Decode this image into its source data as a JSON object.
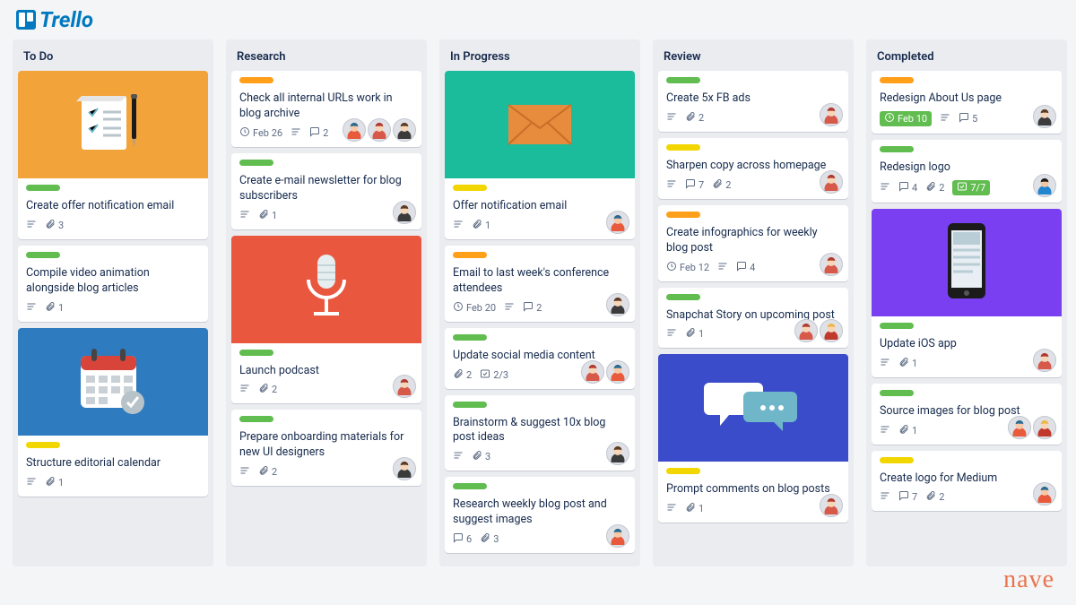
{
  "app": {
    "logo_text": "Trello"
  },
  "footer": {
    "brand": "nave"
  },
  "avatars": {
    "a1": {
      "hair": "#2b6a8f",
      "skin": "#f7c9a8",
      "shirt": "#e85a3b"
    },
    "a2": {
      "hair": "#5b3b22",
      "skin": "#f7d6b8",
      "shirt": "#3b3b3b"
    },
    "a3": {
      "hair": "#1a1a1a",
      "skin": "#f2c6a0",
      "shirt": "#2185d0"
    },
    "a4": {
      "hair": "#b03a2e",
      "skin": "#f7d6b8",
      "shirt": "#d7594a"
    },
    "a5": {
      "hair": "#f0b84a",
      "skin": "#f7d6b8",
      "shirt": "#c0392b"
    }
  },
  "colors": {
    "cover_orange": "#f2a33a",
    "cover_blue": "#2e7bbf",
    "cover_red": "#e9573f",
    "cover_teal": "#1abc9c",
    "cover_indigo": "#3b4cca",
    "cover_purple": "#7b3ff2"
  },
  "lists": [
    {
      "title": "To Do",
      "cards": [
        {
          "cover": "note_orange",
          "label": "green",
          "title": "Create offer notification email",
          "badges": {
            "desc": true,
            "attach": 3
          }
        },
        {
          "label": "green",
          "title": "Compile video animation alongside blog articles",
          "badges": {
            "desc": true,
            "attach": 1
          }
        },
        {
          "cover": "calendar_blue",
          "label": "yellow",
          "title": "Structure editorial calendar",
          "badges": {
            "desc": true,
            "attach": 1
          }
        }
      ]
    },
    {
      "title": "Research",
      "cards": [
        {
          "label": "orange",
          "title": "Check all internal URLs work in blog archive",
          "badges": {
            "due": "Feb 26",
            "desc": true,
            "comments": 2
          },
          "members": [
            "a1",
            "a4",
            "a2"
          ]
        },
        {
          "label": "green",
          "title": "Create e-mail newsletter for blog subscribers",
          "badges": {
            "desc": true,
            "attach": 1
          },
          "members": [
            "a2"
          ]
        },
        {
          "cover": "mic_red",
          "label": "green",
          "title": "Launch podcast",
          "badges": {
            "desc": true,
            "attach": 2
          },
          "members": [
            "a4"
          ]
        },
        {
          "label": "green",
          "title": "Prepare onboarding materials for new UI designers",
          "badges": {
            "desc": true,
            "attach": 2
          },
          "members": [
            "a2"
          ]
        }
      ]
    },
    {
      "title": "In Progress",
      "cards": [
        {
          "cover": "mail_teal",
          "label": "yellow",
          "title": "Offer notification email",
          "badges": {
            "desc": true,
            "attach": 1
          },
          "members": [
            "a1"
          ]
        },
        {
          "label": "orange",
          "title": "Email to last week's conference attendees",
          "badges": {
            "due": "Feb 20",
            "desc": true,
            "comments": 2
          },
          "members": [
            "a2"
          ]
        },
        {
          "label": "green",
          "title": "Update social media content",
          "badges": {
            "attach": 2,
            "check": "2/3"
          },
          "members": [
            "a4",
            "a1"
          ]
        },
        {
          "label": "green",
          "title": "Brainstorm & suggest 10x blog post ideas",
          "badges": {
            "desc": true,
            "attach": 3
          },
          "members": [
            "a2"
          ]
        },
        {
          "label": "green",
          "title": "Research weekly blog post and suggest images",
          "badges": {
            "attach": 3,
            "comments": 6
          },
          "members": [
            "a1"
          ]
        }
      ]
    },
    {
      "title": "Review",
      "cards": [
        {
          "label": "green",
          "title": "Create 5x FB ads",
          "badges": {
            "desc": true,
            "attach": 2
          },
          "members": [
            "a4"
          ]
        },
        {
          "label": "yellow",
          "title": "Sharpen copy across homepage",
          "badges": {
            "desc": true,
            "comments": 7,
            "attach": 2
          },
          "members": [
            "a4"
          ]
        },
        {
          "label": "orange",
          "title": "Create infographics for weekly blog post",
          "badges": {
            "due": "Feb 12",
            "desc": true,
            "comments": 4
          },
          "members": [
            "a4"
          ]
        },
        {
          "label": "green",
          "title": "Snapchat Story on upcoming post",
          "badges": {
            "desc": true,
            "attach": 1
          },
          "members": [
            "a4",
            "a5"
          ]
        },
        {
          "cover": "chat_indigo",
          "label": "yellow",
          "title": "Prompt comments on blog posts",
          "badges": {
            "desc": true,
            "attach": 1
          },
          "members": [
            "a4"
          ]
        }
      ]
    },
    {
      "title": "Completed",
      "cards": [
        {
          "label": "orange",
          "title": "Redesign About Us page",
          "badges": {
            "due_done": "Feb 10",
            "desc": true,
            "comments": 5
          },
          "members": [
            "a2"
          ]
        },
        {
          "label": "green",
          "title": "Redesign logo",
          "badges": {
            "desc": true,
            "comments": 4,
            "attach": 2,
            "check_done": "7/7"
          },
          "members": [
            "a3"
          ]
        },
        {
          "cover": "phone_purple",
          "label": "green",
          "title": "Update iOS app",
          "badges": {
            "desc": true,
            "attach": 1
          },
          "members": [
            "a4"
          ]
        },
        {
          "label": "green",
          "title": "Source images for blog post",
          "badges": {
            "desc": true,
            "attach": 1
          },
          "members": [
            "a1",
            "a5"
          ]
        },
        {
          "label": "yellow",
          "title": "Create logo for Medium",
          "badges": {
            "desc": true,
            "comments": 7,
            "attach": 2
          },
          "members": [
            "a1"
          ]
        }
      ]
    }
  ]
}
